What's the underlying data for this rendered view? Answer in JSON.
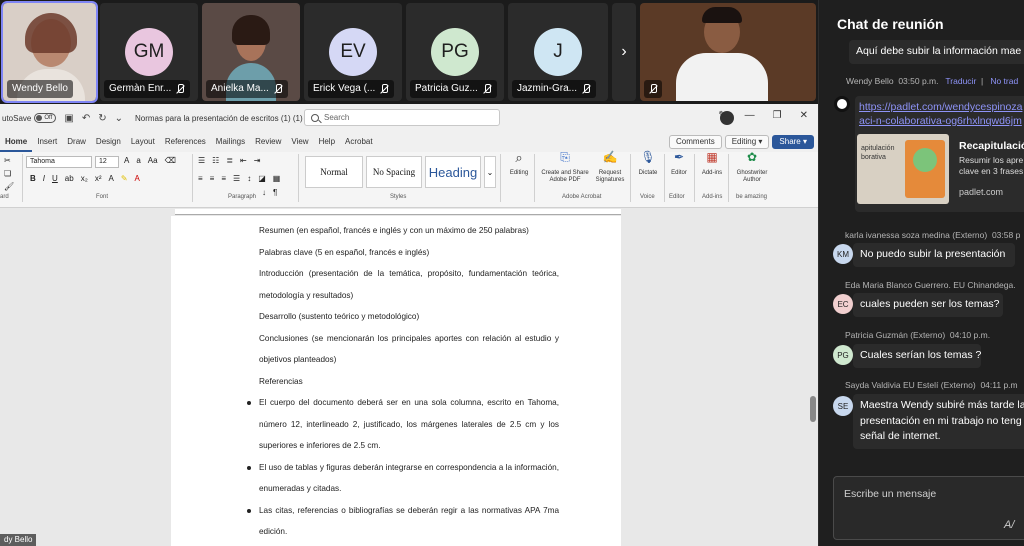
{
  "participants": [
    {
      "name": "Wendy Bello",
      "initials": "",
      "color": "",
      "video": true
    },
    {
      "name": "Germàn Enr...",
      "initials": "GM",
      "color": "#e9c6df",
      "video": false
    },
    {
      "name": "Anielka Ma...",
      "initials": "",
      "color": "",
      "video": true
    },
    {
      "name": "Erick Vega (...",
      "initials": "EV",
      "color": "#d5d8f5",
      "video": false
    },
    {
      "name": "Patricia Guz...",
      "initials": "PG",
      "color": "#cfe8cf",
      "video": false
    },
    {
      "name": "Jazmin-Gra...",
      "initials": "J",
      "color": "#cfe6f3",
      "video": false
    }
  ],
  "strip_next": "›",
  "self_view_label": "dy Bello",
  "word": {
    "autosave_label": "utoSave",
    "autosave_state": "Off",
    "doc_title": "Normas para la presentación de escritos (1) (1) ▾",
    "search_placeholder": "Search",
    "tabs": [
      "Home",
      "Insert",
      "Draw",
      "Design",
      "Layout",
      "References",
      "Mailings",
      "Review",
      "View",
      "Help",
      "Acrobat"
    ],
    "comments_label": "Comments",
    "editing_label": "Editing ▾",
    "share_label": "Share ▾",
    "font_name": "Tahoma",
    "font_size": "12",
    "groups": {
      "font": "Font",
      "paragraph": "Paragraph",
      "styles": "Styles",
      "adobe": "Adobe Acrobat",
      "voice": "Voice",
      "editor": "Editor",
      "addins": "Add-ins",
      "amazing": "be amazing",
      "clipboard": "ard"
    },
    "styles": [
      "Normal",
      "No Spacing",
      "Heading"
    ],
    "ribbon_buttons": {
      "editing": "Editing",
      "create_share": "Create and Share Adobe PDF",
      "request_sig": "Request Signatures",
      "dictate": "Dictate",
      "editor": "Editor",
      "addins": "Add-ins",
      "ghostwriter": "Ghostwriter Author"
    },
    "document": {
      "paragraphs": [
        "Resumen (en español, francés e inglés y con un máximo de 250 palabras)",
        "Palabras clave (5 en español, francés e inglés)",
        "Introducción (presentación de la temática, propósito, fundamentación teórica, metodología y resultados)",
        "Desarrollo (sustento teórico y metodológico)",
        "Conclusiones (se mencionarán los principales aportes con relación al estudio y objetivos planteados)",
        "Referencias"
      ],
      "bullets": [
        "El cuerpo del documento deberá ser en una sola columna, escrito en Tahoma, número 12, interlineado 2, justificado, los márgenes laterales de 2.5 cm y los superiores e inferiores de 2.5 cm.",
        "El uso de tablas y figuras deberán integrarse en correspondencia a la información, enumeradas y citadas.",
        "Las citas, referencias o bibliografías se deberán regir a las normativas APA 7ma edición."
      ]
    }
  },
  "chat": {
    "title": "Chat de reunión",
    "top_message": "Aquí debe subir la información mae",
    "wendy_meta": {
      "sender": "Wendy Bello",
      "time": "03:50 p.m.",
      "translate": "Traducir",
      "no_translate": "No trad"
    },
    "link": {
      "url_line1": "https://padlet.com/wendycespinoza",
      "url_line2": "aci-n-colaborativa-og6rhxlnqwd6jm",
      "thumb_text": "apitulación\nborativa",
      "title": "Recapitulación",
      "desc_line1": "Resumir los apre",
      "desc_line2": "clave en 3 frases",
      "domain": "padlet.com"
    },
    "messages": [
      {
        "sender": "karla ivanessa soza medina (Externo)",
        "time": "03:58 p",
        "initials": "KM",
        "color": "#c8d8ee",
        "lines": [
          "No puedo subir la presentación"
        ]
      },
      {
        "sender": "Eda Maria Blanco Guerrero. EU Chinandega.",
        "time": "",
        "initials": "EC",
        "color": "#f1cfcf",
        "lines": [
          "cuales pueden ser los temas?"
        ]
      },
      {
        "sender": "Patricia Guzmán (Externo)",
        "time": "04:10 p.m.",
        "initials": "PG",
        "color": "#cfe8cf",
        "lines": [
          "Cuales serían los temas ?"
        ]
      },
      {
        "sender": "Sayda Valdivia EU Estelí (Externo)",
        "time": "04:11 p.m",
        "initials": "SE",
        "color": "#c8d8ee",
        "lines": [
          "Maestra Wendy subiré más tarde la",
          "presentación en mi trabajo no teng",
          "señal de internet."
        ]
      }
    ],
    "compose_placeholder": "Escribe un mensaje",
    "format_icon": "A/"
  }
}
